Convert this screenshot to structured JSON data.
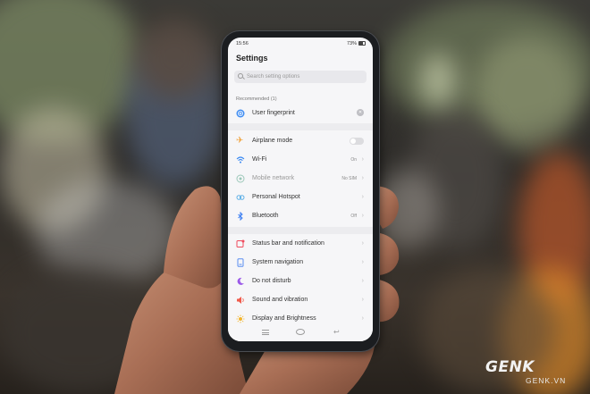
{
  "status_bar": {
    "time": "15:56",
    "battery": "73%"
  },
  "settings": {
    "title": "Settings",
    "search_placeholder": "Search setting options",
    "recommended_label": "Recommended (1)",
    "recommended": [
      {
        "label": "User fingerprint",
        "icon": "fingerprint-icon"
      }
    ],
    "network": [
      {
        "label": "Airplane mode",
        "icon": "airplane-icon",
        "control": "toggle",
        "toggle_on": false
      },
      {
        "label": "Wi-Fi",
        "icon": "wifi-icon",
        "value": "On"
      },
      {
        "label": "Mobile network",
        "icon": "mobile-network-icon",
        "value": "No SIM",
        "muted": true
      },
      {
        "label": "Personal Hotspot",
        "icon": "hotspot-icon"
      },
      {
        "label": "Bluetooth",
        "icon": "bluetooth-icon",
        "value": "Off"
      }
    ],
    "system": [
      {
        "label": "Status bar and notification",
        "icon": "notification-icon"
      },
      {
        "label": "System navigation",
        "icon": "navigation-icon"
      },
      {
        "label": "Do not disturb",
        "icon": "moon-icon"
      },
      {
        "label": "Sound and vibration",
        "icon": "speaker-icon"
      },
      {
        "label": "Display and Brightness",
        "icon": "sun-icon"
      }
    ]
  },
  "watermark": {
    "logo": "GENK",
    "url": "GENK.VN"
  },
  "colors": {
    "airplane": "#f0a23b",
    "wifi": "#3d8bf2",
    "hotspot": "#5fb0e6",
    "bluetooth": "#3d7ff2",
    "notification": "#ef4b5d",
    "navigation": "#5a8df0",
    "moon": "#9b59e8",
    "speaker": "#f05a4b",
    "sun": "#f3b52c"
  }
}
